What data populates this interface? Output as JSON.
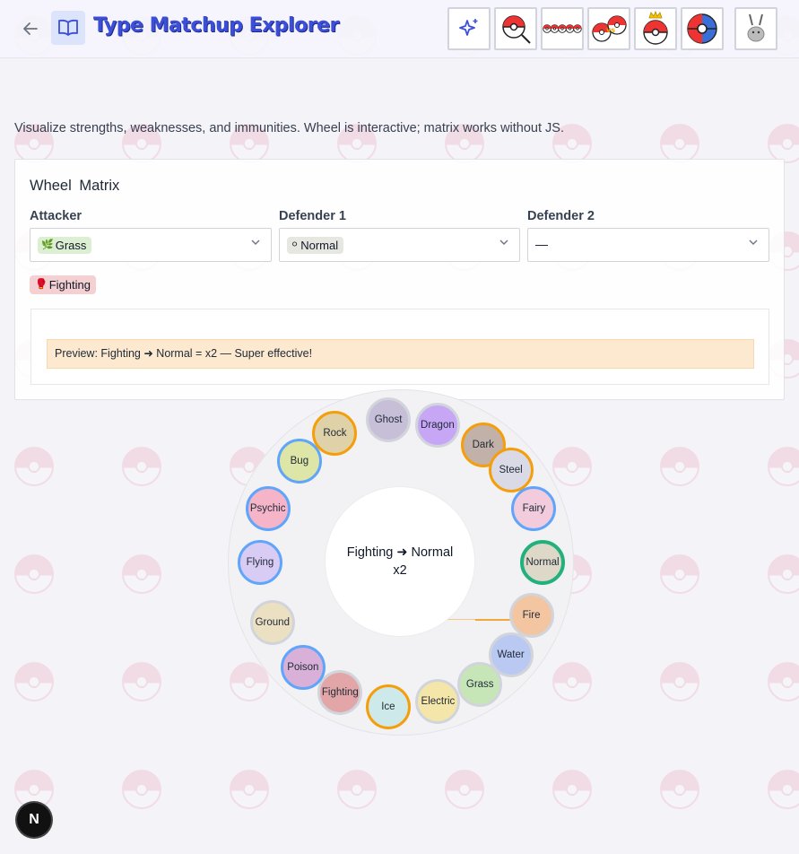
{
  "header": {
    "title": "Type Matchup Explorer"
  },
  "tools": [
    {
      "name": "sparkle-icon"
    },
    {
      "name": "pokeball-search-icon"
    },
    {
      "name": "pokeball-row-icon"
    },
    {
      "name": "pokeball-versus-icon"
    },
    {
      "name": "pokeball-crown-icon"
    },
    {
      "name": "pokeball-target-icon"
    },
    {
      "name": "rabbit-icon"
    }
  ],
  "subtitle": "Visualize strengths, weaknesses, and immunities. Wheel is interactive; matrix works without JS.",
  "tabs": [
    "Wheel",
    "Matrix"
  ],
  "attacker": {
    "label": "Attacker",
    "value": "Grass",
    "emoji": "🌿",
    "color": "#dcefd3"
  },
  "defender1": {
    "label": "Defender 1",
    "value": "Normal",
    "emoji": "⚪",
    "color": "#e7e7e2"
  },
  "defender2": {
    "label": "Defender 2",
    "value": "—"
  },
  "selected_chip": {
    "label": "Fighting",
    "emoji": "🥊"
  },
  "preview": "Preview: Fighting ➜ Normal = x2 — Super effective!",
  "wheel": {
    "center_line1": "Fighting ➜ Normal",
    "center_line2": "x2",
    "types": [
      {
        "label": "Ghost",
        "color": "#c7bed8",
        "ring": "g"
      },
      {
        "label": "Dragon",
        "color": "#c7a6f6",
        "ring": "g"
      },
      {
        "label": "Dark",
        "color": "#c2b1a8",
        "ring": "o"
      },
      {
        "label": "Steel",
        "color": "#dadae6",
        "ring": "o"
      },
      {
        "label": "Fairy",
        "color": "#f2cbdc",
        "ring": "b"
      },
      {
        "label": "Normal",
        "color": "#ddd8c7",
        "ring": "n"
      },
      {
        "label": "Fire",
        "color": "#f3c5a1",
        "ring": "g"
      },
      {
        "label": "Water",
        "color": "#b9c9f1",
        "ring": "g"
      },
      {
        "label": "Grass",
        "color": "#c7e6b7",
        "ring": "g"
      },
      {
        "label": "Electric",
        "color": "#f4e6a8",
        "ring": "g"
      },
      {
        "label": "Ice",
        "color": "#cde9e9",
        "ring": "o"
      },
      {
        "label": "Fighting",
        "color": "#e3a6a8",
        "ring": "g"
      },
      {
        "label": "Poison",
        "color": "#d8b0d8",
        "ring": "b"
      },
      {
        "label": "Ground",
        "color": "#ece0c2",
        "ring": "g"
      },
      {
        "label": "Flying",
        "color": "#d8ccf4",
        "ring": "b"
      },
      {
        "label": "Psychic",
        "color": "#f5b4c8",
        "ring": "b"
      },
      {
        "label": "Bug",
        "color": "#dde6a6",
        "ring": "b"
      },
      {
        "label": "Rock",
        "color": "#e0d2a8",
        "ring": "o"
      }
    ]
  },
  "badge": "N"
}
